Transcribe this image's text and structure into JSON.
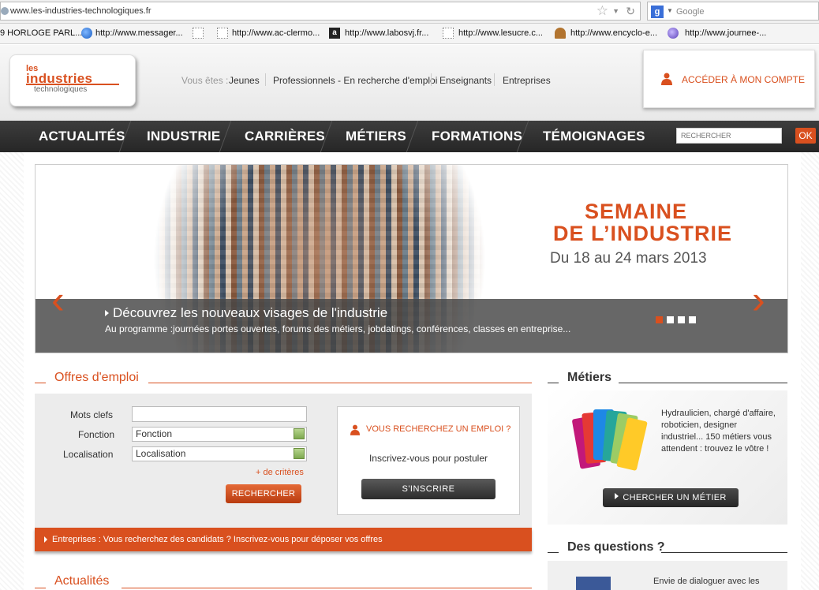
{
  "browser": {
    "url": "www.les-industries-technologiques.fr",
    "search_placeholder": "Google",
    "bookmarks": [
      "9 HORLOGE PARL...",
      "http://www.messager...",
      "http://www.ac-clermo...",
      "http://www.labosvj.fr...",
      "http://www.lesucre.c...",
      "http://www.encyclo-e...",
      "http://www.journee-..."
    ]
  },
  "header": {
    "logo_les": "les",
    "logo_industries": "industries",
    "logo_tech": "technologiques",
    "vous_etes": "Vous êtes :",
    "audiences": [
      "Jeunes",
      "Professionnels - En recherche d'emploi",
      "Enseignants",
      "Entreprises"
    ],
    "account_label": "ACCÉDER À MON COMPTE"
  },
  "nav": {
    "items": [
      "ACTUALITÉS",
      "INDUSTRIE",
      "CARRIÈRES",
      "MÉTIERS",
      "FORMATIONS",
      "TÉMOIGNAGES"
    ],
    "search_placeholder": "RECHERCHER",
    "ok_label": "OK"
  },
  "banner": {
    "title_line1": "SEMAINE",
    "title_line2": "DE L’INDUSTRIE",
    "date": "Du 18 au 24 mars 2013",
    "headline": "Découvrez les nouveaux visages de l'industrie",
    "subtitle": "Au programme :journées portes ouvertes, forums des métiers, jobdatings, conférences, classes en entreprise...",
    "prev_arrow": "‹",
    "next_arrow": "›",
    "slides": 4,
    "active_slide": 1
  },
  "offres": {
    "title": "Offres d'emploi",
    "label_mots": "Mots clefs",
    "label_fonction": "Fonction",
    "label_localisation": "Localisation",
    "mots_value": "",
    "fonction_value": "Fonction",
    "localisation_value": "Localisation",
    "more": "+ de critères",
    "search_button": "RECHERCHER",
    "card_title": "VOUS RECHERCHEZ UN EMPLOI ?",
    "card_text": "Inscrivez-vous pour postuler",
    "card_button": "S'INSCRIRE",
    "entreprises_bar": "Entreprises : Vous recherchez des candidats ? Inscrivez-vous pour déposer vos offres"
  },
  "metiers": {
    "title": "Métiers",
    "text": "Hydraulicien, chargé d'affaire, roboticien, designer industriel... 150 métiers vous attendent : trouvez le vôtre !",
    "button": "CHERCHER UN MÉTIER"
  },
  "questions": {
    "title": "Des questions ?",
    "text": "Envie de dialoguer avec les"
  },
  "actualites": {
    "title": "Actualités"
  },
  "colors": {
    "accent": "#d9501f",
    "nav_bg": "#2e2e2e"
  }
}
